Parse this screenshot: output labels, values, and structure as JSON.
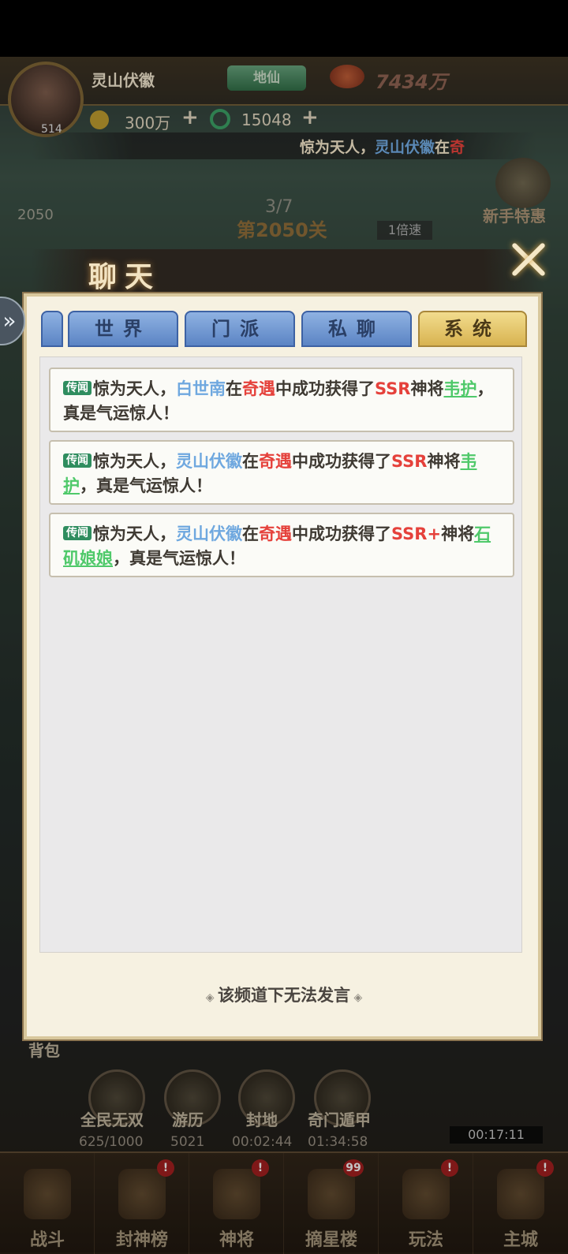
{
  "header": {
    "player_name": "灵山伏徽",
    "rank": "地仙",
    "power": "7434万",
    "avatar_level": "514",
    "coins": "300万",
    "jade": "15048",
    "plus": "+"
  },
  "marquee": {
    "prefix": "惊为天人，",
    "name": "灵山伏徽",
    "mid": "在",
    "tail": "奇"
  },
  "stage": {
    "progress": "3/7",
    "title": "第2050关",
    "left_num": "2050",
    "speed": "1倍速",
    "newbie": "新手特惠"
  },
  "chat": {
    "title": "聊天",
    "tabs": [
      {
        "label": "世界",
        "active": false
      },
      {
        "label": "门派",
        "active": false
      },
      {
        "label": "私聊",
        "active": false
      },
      {
        "label": "系统",
        "active": true
      }
    ],
    "messages": [
      {
        "tag": "传闻",
        "prefix": "惊为天人，",
        "name": "白世南",
        "t1": "在",
        "event": "奇遇",
        "t2": "中成功获得了",
        "grade": "SSR",
        "t3": "神将",
        "hero": "韦护",
        "suffix": "，真是气运惊人！"
      },
      {
        "tag": "传闻",
        "prefix": "惊为天人，",
        "name": "灵山伏徽",
        "t1": "在",
        "event": "奇遇",
        "t2": "中成功获得了",
        "grade": "SSR",
        "t3": "神将",
        "hero": "韦护",
        "suffix": "，真是气运惊人！"
      },
      {
        "tag": "传闻",
        "prefix": "惊为天人，",
        "name": "灵山伏徽",
        "t1": "在",
        "event": "奇遇",
        "t2": "中成功获得了",
        "grade": "SSR+",
        "t3": "神将",
        "hero": "石矶娘娘",
        "suffix": "，真是气运惊人！"
      }
    ],
    "notice": "该频道下无法发言"
  },
  "functions": [
    {
      "label": "全民无双",
      "counter": "625/1000"
    },
    {
      "label": "游历",
      "counter": "5021"
    },
    {
      "label": "封地",
      "counter": "00:02:44"
    },
    {
      "label": "奇门遁甲",
      "counter": "01:34:58"
    }
  ],
  "backpack": "背包",
  "timer": "00:17:11",
  "nav": [
    {
      "label": "战斗",
      "badge": ""
    },
    {
      "label": "封神榜",
      "badge": "!"
    },
    {
      "label": "神将",
      "badge": "!"
    },
    {
      "label": "摘星楼",
      "badge": "99"
    },
    {
      "label": "玩法",
      "badge": "!"
    },
    {
      "label": "主城",
      "badge": "!"
    }
  ]
}
